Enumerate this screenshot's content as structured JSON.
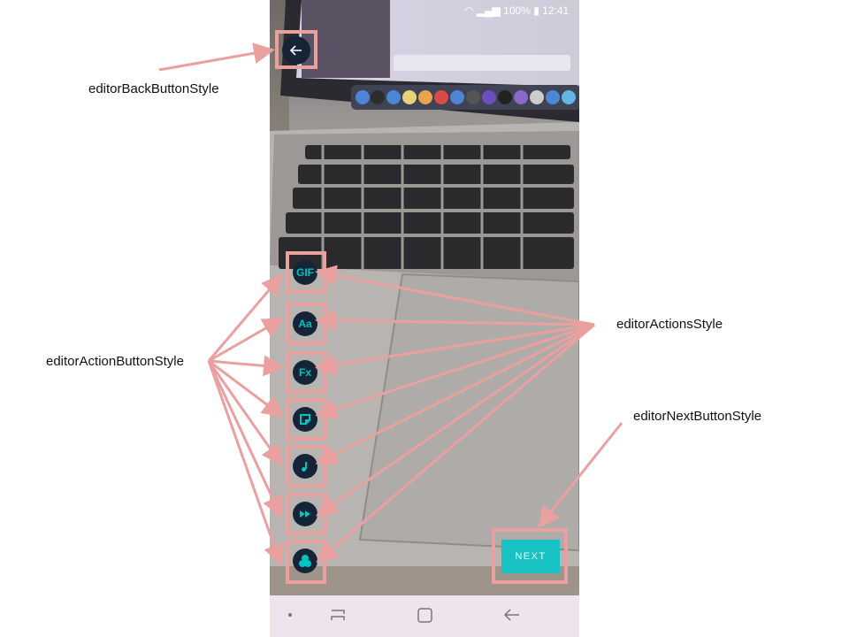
{
  "status_bar": {
    "battery": "100%",
    "time": "12:41"
  },
  "annotations": {
    "back": "editorBackButtonStyle",
    "action_button": "editorActionButtonStyle",
    "actions": "editorActionsStyle",
    "next": "editorNextButtonStyle"
  },
  "editor": {
    "back_icon": "arrow-left-icon",
    "actions": [
      {
        "icon": "gif-icon",
        "glyph": "GIF"
      },
      {
        "icon": "text-icon",
        "glyph": "Aa"
      },
      {
        "icon": "effects-icon",
        "glyph": "Fx"
      },
      {
        "icon": "sticker-icon",
        "glyph": ""
      },
      {
        "icon": "music-note-icon",
        "glyph": ""
      },
      {
        "icon": "fast-forward-icon",
        "glyph": ""
      },
      {
        "icon": "filter-icon",
        "glyph": ""
      }
    ],
    "next_label": "NEXT"
  },
  "nav_bar": {
    "icons": [
      "dot-icon",
      "recent-apps-icon",
      "home-icon",
      "back-icon"
    ]
  },
  "colors": {
    "highlight": "#eba0a0",
    "accent": "#18c2c2",
    "button_bg": "#152436"
  }
}
